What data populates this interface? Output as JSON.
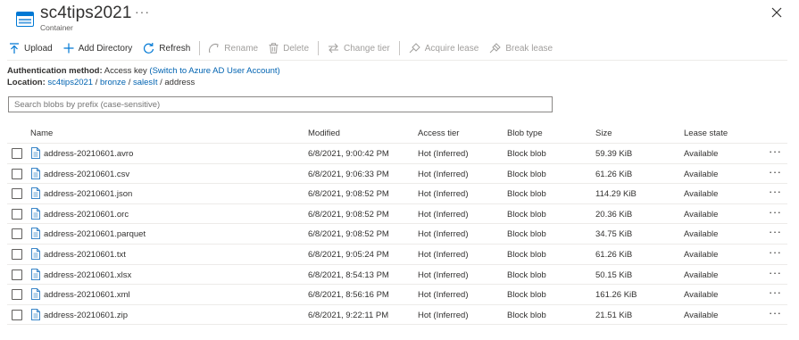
{
  "header": {
    "title": "sc4tips2021",
    "subtitle": "Container",
    "more": "···"
  },
  "toolbar": {
    "upload": "Upload",
    "add_directory": "Add Directory",
    "refresh": "Refresh",
    "rename": "Rename",
    "delete": "Delete",
    "change_tier": "Change tier",
    "acquire_lease": "Acquire lease",
    "break_lease": "Break lease"
  },
  "auth": {
    "label": "Authentication method:",
    "value": "Access key",
    "link": "(Switch to Azure AD User Account)"
  },
  "location": {
    "label": "Location:",
    "path": [
      "sc4tips2021",
      "bronze",
      "salesIt",
      "address"
    ],
    "separator": "/"
  },
  "search": {
    "placeholder": "Search blobs by prefix (case-sensitive)"
  },
  "table": {
    "columns": {
      "name": "Name",
      "modified": "Modified",
      "access_tier": "Access tier",
      "blob_type": "Blob type",
      "size": "Size",
      "lease_state": "Lease state"
    },
    "row_more": "···",
    "rows": [
      {
        "name": "address-20210601.avro",
        "modified": "6/8/2021, 9:00:42 PM",
        "tier": "Hot (Inferred)",
        "type": "Block blob",
        "size": "59.39 KiB",
        "lease": "Available"
      },
      {
        "name": "address-20210601.csv",
        "modified": "6/8/2021, 9:06:33 PM",
        "tier": "Hot (Inferred)",
        "type": "Block blob",
        "size": "61.26 KiB",
        "lease": "Available"
      },
      {
        "name": "address-20210601.json",
        "modified": "6/8/2021, 9:08:52 PM",
        "tier": "Hot (Inferred)",
        "type": "Block blob",
        "size": "114.29 KiB",
        "lease": "Available"
      },
      {
        "name": "address-20210601.orc",
        "modified": "6/8/2021, 9:08:52 PM",
        "tier": "Hot (Inferred)",
        "type": "Block blob",
        "size": "20.36 KiB",
        "lease": "Available"
      },
      {
        "name": "address-20210601.parquet",
        "modified": "6/8/2021, 9:08:52 PM",
        "tier": "Hot (Inferred)",
        "type": "Block blob",
        "size": "34.75 KiB",
        "lease": "Available"
      },
      {
        "name": "address-20210601.txt",
        "modified": "6/8/2021, 9:05:24 PM",
        "tier": "Hot (Inferred)",
        "type": "Block blob",
        "size": "61.26 KiB",
        "lease": "Available"
      },
      {
        "name": "address-20210601.xlsx",
        "modified": "6/8/2021, 8:54:13 PM",
        "tier": "Hot (Inferred)",
        "type": "Block blob",
        "size": "50.15 KiB",
        "lease": "Available"
      },
      {
        "name": "address-20210601.xml",
        "modified": "6/8/2021, 8:56:16 PM",
        "tier": "Hot (Inferred)",
        "type": "Block blob",
        "size": "161.26 KiB",
        "lease": "Available"
      },
      {
        "name": "address-20210601.zip",
        "modified": "6/8/2021, 9:22:11 PM",
        "tier": "Hot (Inferred)",
        "type": "Block blob",
        "size": "21.51 KiB",
        "lease": "Available"
      }
    ]
  },
  "colors": {
    "accent": "#0078d4",
    "link": "#0063b1",
    "disabled": "#a19f9d",
    "icon_blue": "#3a86c8"
  }
}
